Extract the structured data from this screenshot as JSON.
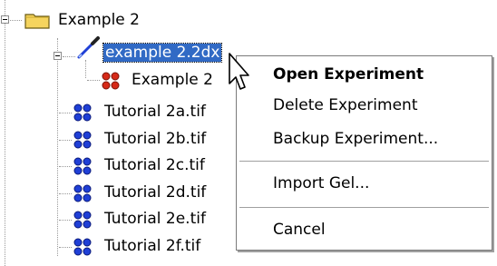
{
  "tree": {
    "root": {
      "label": "Example 2"
    },
    "experiment": {
      "label": "example 2.2dx"
    },
    "experiment_child": {
      "label": "Example 2"
    },
    "images": [
      {
        "label": "Tutorial 2a.tif"
      },
      {
        "label": "Tutorial 2b.tif"
      },
      {
        "label": "Tutorial 2c.tif"
      },
      {
        "label": "Tutorial 2d.tif"
      },
      {
        "label": "Tutorial 2e.tif"
      },
      {
        "label": "Tutorial 2f.tif"
      }
    ]
  },
  "context_menu": {
    "open_experiment": "Open Experiment",
    "delete_experiment": "Delete Experiment",
    "backup_experiment": "Backup Experiment...",
    "import_gel": "Import Gel...",
    "cancel": "Cancel"
  },
  "colors": {
    "selection": "#316ac5",
    "folder": "#f5d45e",
    "blue_dots": "#1f3fd6",
    "red_dots": "#d62a18"
  }
}
